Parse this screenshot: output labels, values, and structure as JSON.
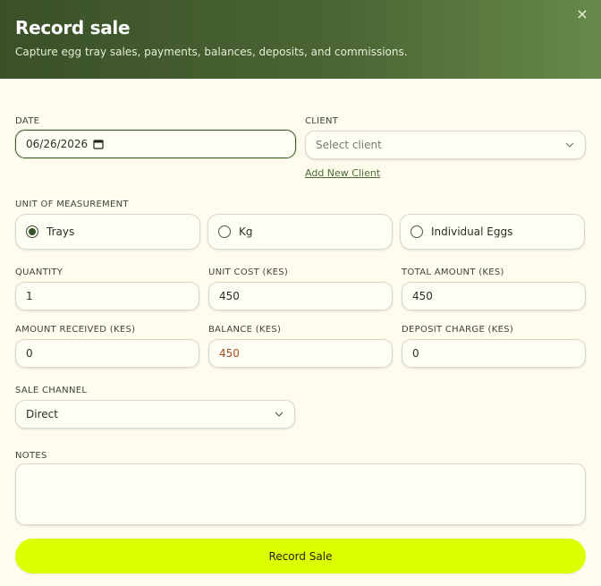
{
  "header": {
    "title": "Record sale",
    "subtitle": "Capture egg tray sales, payments, balances, deposits, and commissions.",
    "close_label": "×"
  },
  "form": {
    "date": {
      "label": "DATE",
      "value": "06/26/2026"
    },
    "client": {
      "label": "CLIENT",
      "placeholder": "Select client",
      "add_link": "Add New Client"
    },
    "unit": {
      "label": "UNIT OF MEASUREMENT",
      "options": [
        "Trays",
        "Kg",
        "Individual Eggs"
      ],
      "selected": "Trays"
    },
    "quantity": {
      "label": "QUANTITY",
      "value": "1"
    },
    "unit_cost": {
      "label": "UNIT COST (KES)",
      "value": "450"
    },
    "total_amount": {
      "label": "TOTAL AMOUNT (KES)",
      "value": "450"
    },
    "amount_received": {
      "label": "AMOUNT RECEIVED (KES)",
      "value": "0"
    },
    "balance": {
      "label": "BALANCE (KES)",
      "value": "450"
    },
    "deposit_charge": {
      "label": "DEPOSIT CHARGE (KES)",
      "value": "0"
    },
    "sale_channel": {
      "label": "SALE CHANNEL",
      "value": "Direct"
    },
    "notes": {
      "label": "NOTES",
      "value": ""
    },
    "submit_label": "Record Sale"
  },
  "colors": {
    "header_dark": "#3a5128",
    "header_light": "#668a49",
    "accent_button": "#dcff00",
    "balance_text": "#a24d22",
    "background": "#fdfced"
  }
}
